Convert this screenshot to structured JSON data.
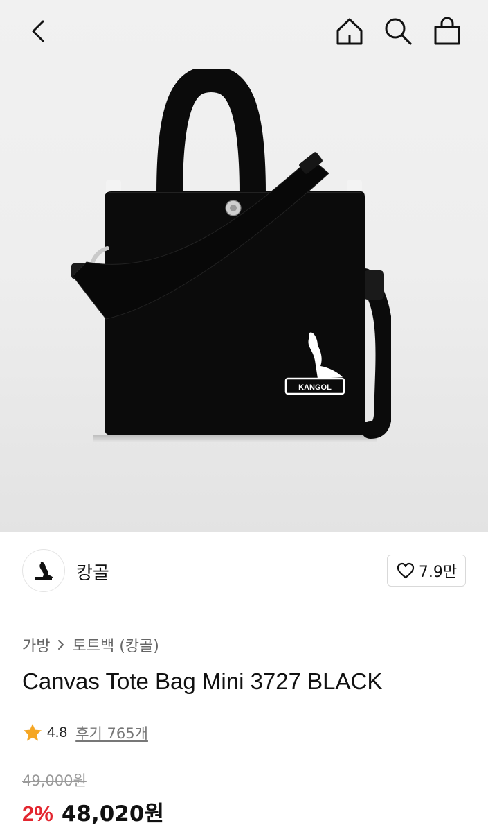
{
  "product": {
    "brand": "캉골",
    "likes": "7.9만",
    "title": "Canvas Tote Bag Mini 3727 BLACK",
    "rating": "4.8",
    "reviews": "후기 765개",
    "original_price": "49,000원",
    "discount": "2%",
    "sale_price": "48,020원",
    "logo_text": "KANGOL"
  },
  "breadcrumb": [
    "가방",
    "토트백 (캉골)"
  ],
  "icons": {
    "back": "chevron-left-icon",
    "home": "home-icon",
    "search": "search-icon",
    "cart": "shopping-bag-icon",
    "like": "heart-icon",
    "star": "star-icon",
    "breadcrumb_separator": "chevron-right-icon"
  },
  "colors": {
    "discount": "#e3262f",
    "star": "#f5a623",
    "bag": "#0b0b0b"
  }
}
